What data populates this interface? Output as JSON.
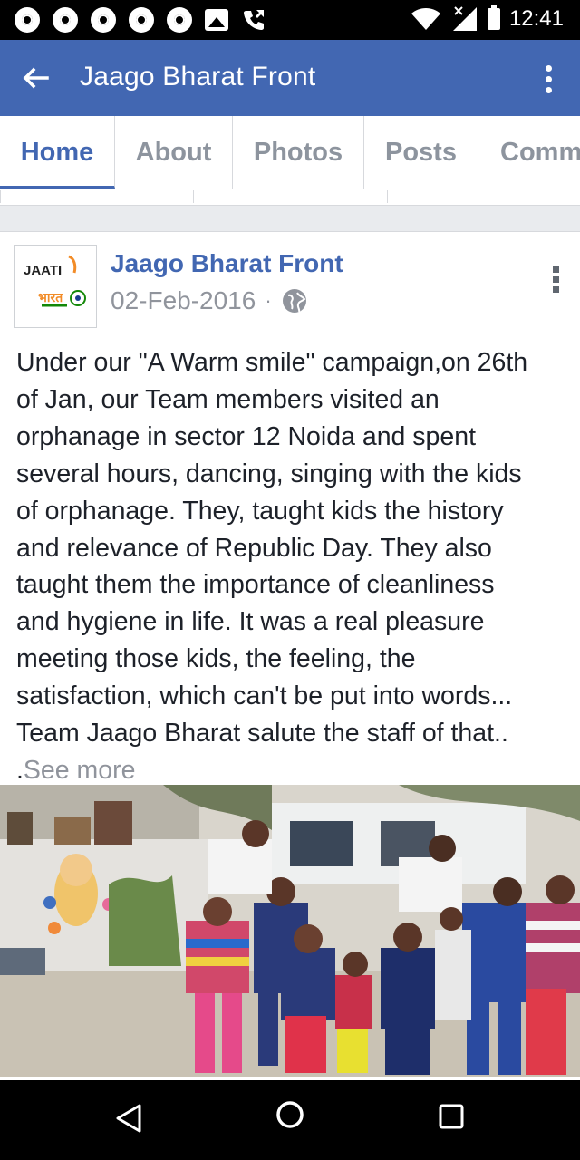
{
  "status_bar": {
    "time": "12:41",
    "icons": [
      "chrome-icon",
      "chrome-icon",
      "chrome-icon",
      "chrome-icon",
      "chrome-icon",
      "gallery-icon",
      "phone-icon",
      "wifi-icon",
      "signal-icon",
      "battery-icon"
    ]
  },
  "app_bar": {
    "title": "Jaago Bharat Front",
    "back_icon": "arrow-left-icon",
    "menu_icon": "more-vertical-icon",
    "color": "#4267b2"
  },
  "tabs": [
    {
      "label": "Home",
      "active": true
    },
    {
      "label": "About",
      "active": false
    },
    {
      "label": "Photos",
      "active": false
    },
    {
      "label": "Posts",
      "active": false
    },
    {
      "label": "Comm",
      "active": false
    }
  ],
  "post": {
    "author": "Jaago Bharat Front",
    "date": "02-Feb-2016",
    "separator": "·",
    "privacy_icon": "globe-icon",
    "avatar_text": "JAATI",
    "lines": [
      "Under our \"A Warm smile\" campaign,on 26th",
      "of Jan, our Team members visited an",
      "orphanage in sector 12 Noida and spent",
      "several hours, dancing, singing with the kids",
      "of orphanage. They, taught kids the history",
      "and relevance of Republic Day. They also",
      "taught them the importance of cleanliness",
      "and hygiene in life. It was a real pleasure",
      "meeting those kids, the feeling, the",
      "satisfaction, which can't be put into words...",
      "Team Jaago Bharat salute  the staff of that.."
    ],
    "see_more_prefix": ".",
    "see_more": "See more"
  },
  "nav_bar": {
    "icons": [
      "nav-back-icon",
      "nav-home-icon",
      "nav-recents-icon"
    ]
  }
}
